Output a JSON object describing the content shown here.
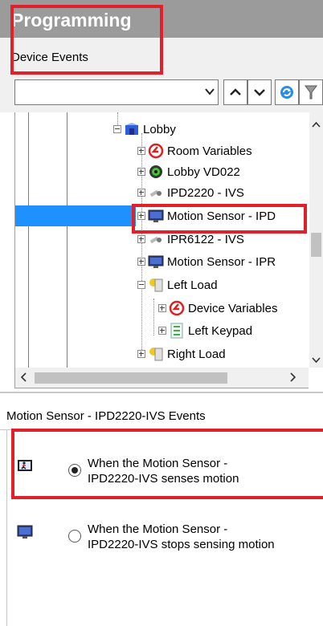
{
  "header": {
    "title": "Programming"
  },
  "subheader": {
    "label": "Device Events"
  },
  "toolbar": {
    "selected_value": "",
    "buttons": [
      "arrow-up",
      "arrow-down",
      "refresh",
      "filter"
    ]
  },
  "tree": {
    "items": [
      {
        "label": "Lobby",
        "icon": "room-icon"
      },
      {
        "label": "Room Variables",
        "icon": "variables-icon"
      },
      {
        "label": "Lobby VD022",
        "icon": "virtual-device-icon"
      },
      {
        "label": "IPD2220 - IVS",
        "icon": "camera-icon"
      },
      {
        "label": "Motion Sensor - IPD",
        "icon": "monitor-icon"
      },
      {
        "label": "IPR6122 - IVS",
        "icon": "camera-icon"
      },
      {
        "label": "Motion Sensor - IPR",
        "icon": "monitor-icon"
      },
      {
        "label": "Left Load",
        "icon": "light-load-icon"
      },
      {
        "label": "Device Variables",
        "icon": "variables-icon"
      },
      {
        "label": "Left Keypad",
        "icon": "keypad-icon"
      },
      {
        "label": "Right Load",
        "icon": "light-load-icon"
      }
    ]
  },
  "events": {
    "title": "Motion Sensor - IPD2220-IVS Events",
    "items": [
      {
        "line1": "When the Motion Sensor -",
        "line2": "IPD2220-IVS senses motion",
        "checked": true,
        "icon": "motion-icon"
      },
      {
        "line1": "When the Motion Sensor -",
        "line2": "IPD2220-IVS stops sensing motion",
        "checked": false,
        "icon": "monitor-icon"
      }
    ]
  },
  "colors": {
    "highlight": "#e0202a",
    "header_bg": "#9b9b9b",
    "selection": "#1e90ff"
  }
}
